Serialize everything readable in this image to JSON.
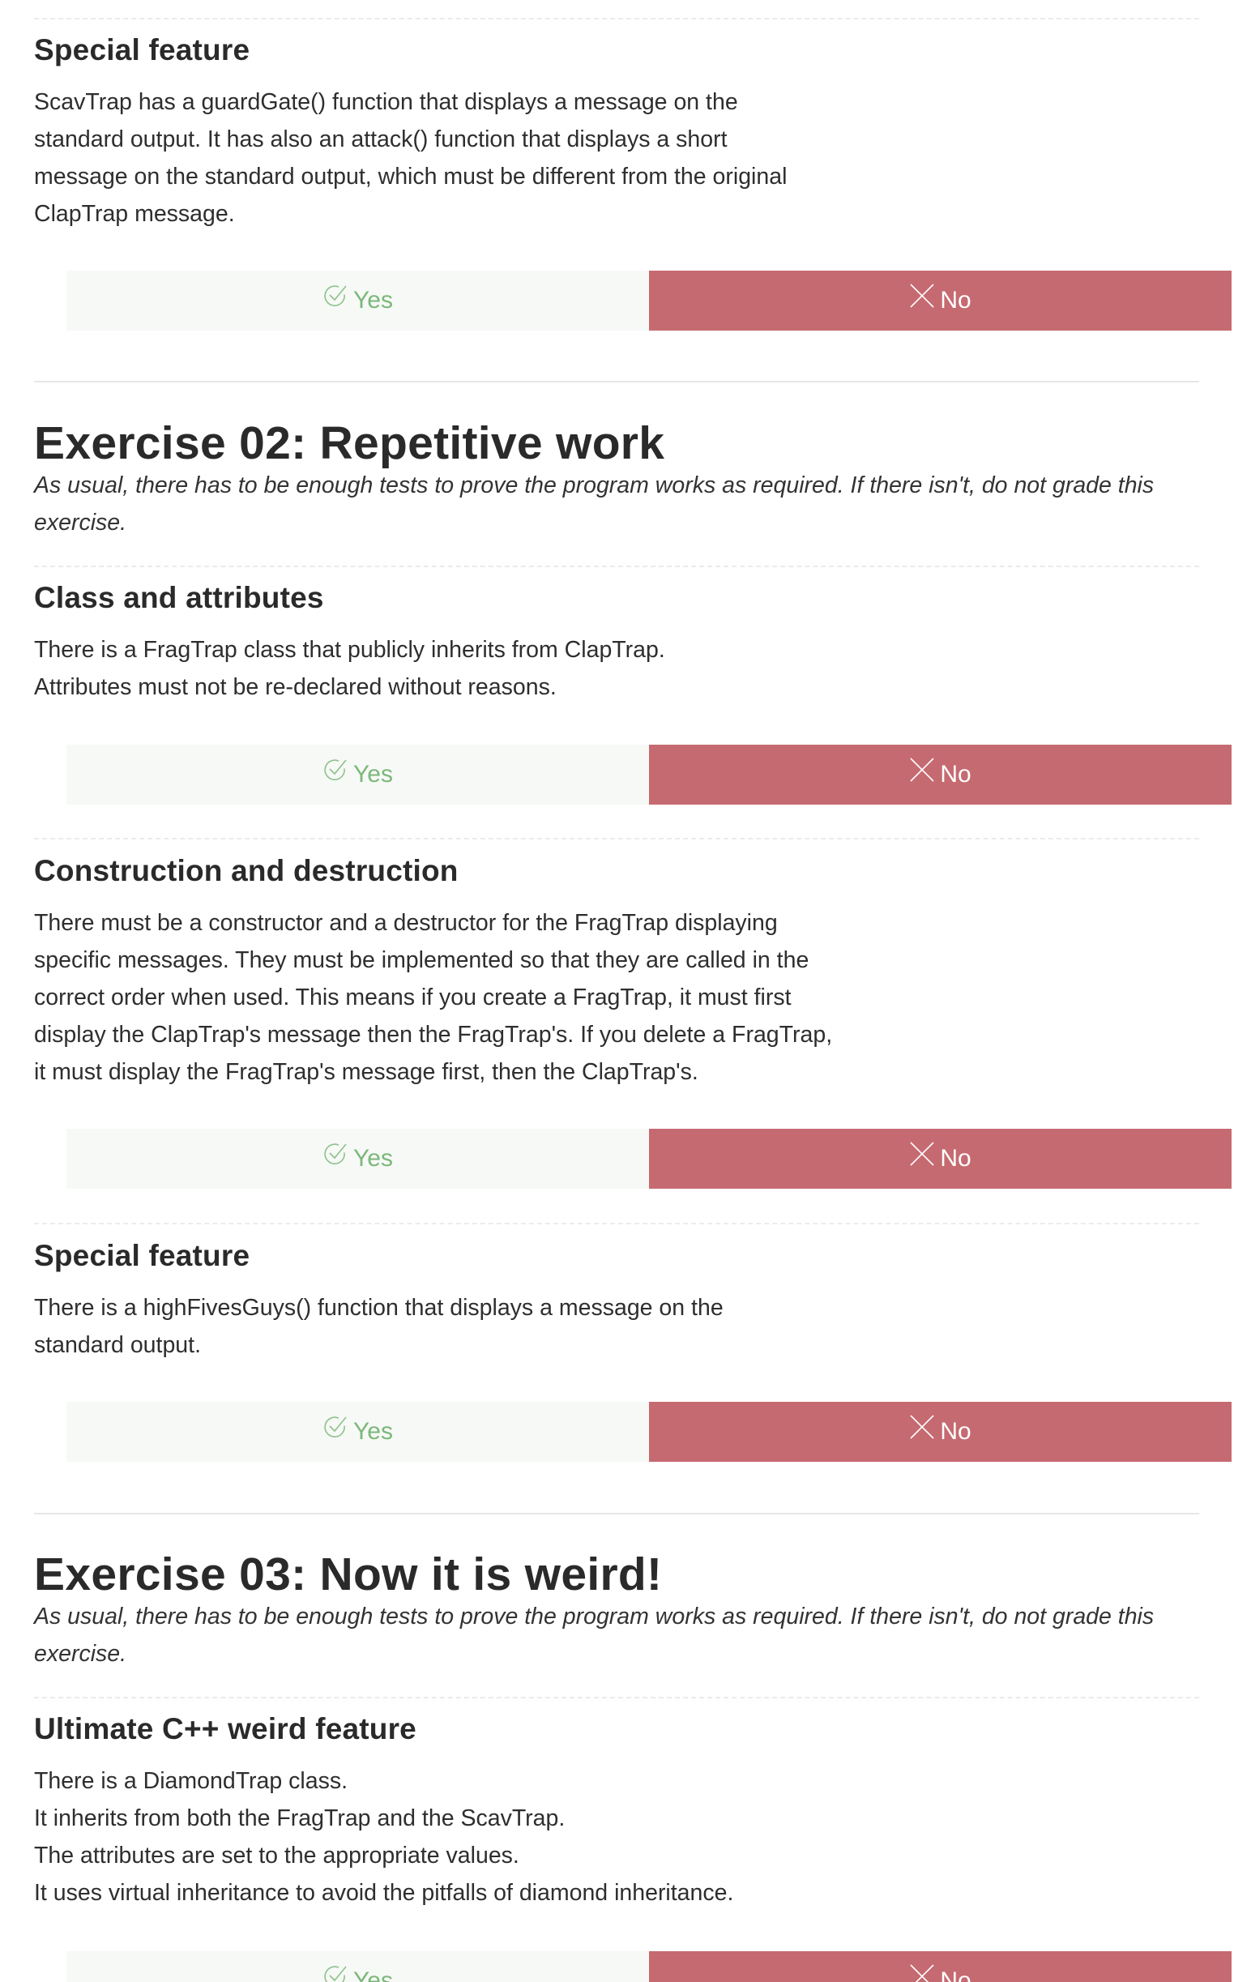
{
  "sections": [
    {
      "title": "Special feature",
      "lines": [
        "ScavTrap has a guardGate() function that displays a message on the",
        "standard output. It has also an attack() function that displays a short",
        "message on the standard output, which must be different from the original",
        "ClapTrap message."
      ],
      "yes_label": "Yes",
      "no_label": "No"
    },
    {
      "exercise_title": "Exercise 02: Repetitive work",
      "exercise_intro": "As usual, there has to be enough tests to prove the program works as required. If there isn't, do not grade this exercise."
    },
    {
      "title": "Class and attributes",
      "lines": [
        "There is a FragTrap class that publicly inherits from ClapTrap.",
        "Attributes must not be re-declared without reasons."
      ],
      "yes_label": "Yes",
      "no_label": "No"
    },
    {
      "title": "Construction and destruction",
      "lines": [
        "There must be a constructor and a destructor for the FragTrap displaying",
        "specific messages. They must be implemented so that they are called in the",
        "correct order when used. This means if you create a FragTrap, it must first",
        "display the ClapTrap's message then the FragTrap's. If you delete a FragTrap,",
        "it must display the FragTrap's message first, then the ClapTrap's."
      ],
      "yes_label": "Yes",
      "no_label": "No"
    },
    {
      "title": "Special feature",
      "lines": [
        "There is a highFivesGuys() function that displays a message on the",
        "standard output."
      ],
      "yes_label": "Yes",
      "no_label": "No"
    },
    {
      "exercise_title": "Exercise 03: Now it is weird!",
      "exercise_intro": "As usual, there has to be enough tests to prove the program works as required. If there isn't, do not grade this exercise."
    },
    {
      "title": "Ultimate C++ weird feature",
      "lines": [
        "There is a DiamondTrap class.",
        "It inherits from both the FragTrap and the ScavTrap.",
        "The attributes are set to the appropriate values.",
        "It uses virtual inheritance to avoid the pitfalls of diamond inheritance."
      ],
      "yes_label": "Yes",
      "no_label": "No"
    }
  ],
  "colors": {
    "yes_bg": "#f7f9f6",
    "yes_text": "#7bb87b",
    "no_bg": "#c66a71",
    "no_text": "#ffffff"
  },
  "icons": {
    "yes": "check-circle-icon",
    "no": "x-icon"
  }
}
